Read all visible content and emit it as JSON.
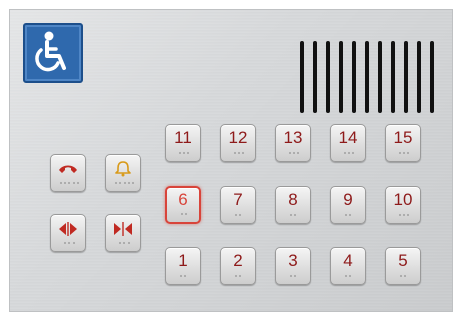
{
  "panel": {
    "accessibility_sign": "wheelchair-icon",
    "speaker": "speaker-grille",
    "colors": {
      "accent_red": "#8e1a1a",
      "active_red": "#d8443a",
      "sign_blue": "#2f69ad",
      "panel_grey": "#d6d8da"
    }
  },
  "floors": {
    "row1": [
      "11",
      "12",
      "13",
      "14",
      "15"
    ],
    "row2": [
      "6",
      "7",
      "8",
      "9",
      "10"
    ],
    "row3": [
      "1",
      "2",
      "3",
      "4",
      "5"
    ],
    "active_floor": "6"
  },
  "function_buttons": [
    {
      "name": "emergency-phone",
      "icon": "phone-icon"
    },
    {
      "name": "alarm-bell",
      "icon": "bell-icon"
    },
    {
      "name": "door-open",
      "icon": "door-open-icon"
    },
    {
      "name": "door-close",
      "icon": "door-close-icon"
    }
  ]
}
